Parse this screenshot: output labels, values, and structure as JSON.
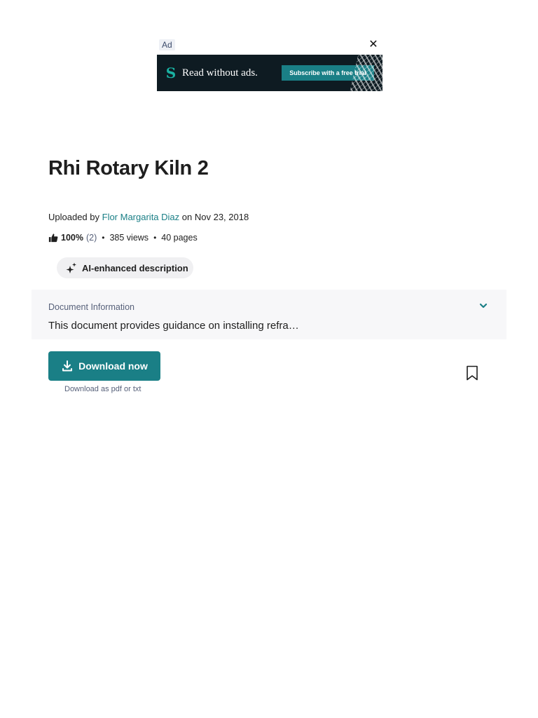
{
  "ad": {
    "tag": "Ad",
    "close_glyph": "✕",
    "logo_glyph": "S",
    "headline": "Read without ads.",
    "cta": "Subscribe with a free trial"
  },
  "document": {
    "title": "Rhi Rotary Kiln 2",
    "uploaded_prefix": "Uploaded by",
    "author": "Flor Margarita Diaz",
    "uploaded_suffix": "on Nov 23, 2018",
    "rating_percent": "100%",
    "rating_count": "(2)",
    "views": "385 views",
    "pages": "40 pages",
    "separator": "•"
  },
  "ai_pill": {
    "label": "AI-enhanced description",
    "icon": "sparkle-icon"
  },
  "info": {
    "label": "Document Information",
    "text": "This document provides guidance on installing refra…",
    "icon": "chevron-down-icon"
  },
  "download": {
    "button_label": "Download now",
    "sub_label": "Download as pdf or txt",
    "icon": "download-icon"
  },
  "bookmark": {
    "icon": "bookmark-icon"
  },
  "colors": {
    "accent": "#1a7f86",
    "ad_background": "#0e1b22",
    "panel_background": "#f7f7f9",
    "pill_background": "#f0f0f2"
  }
}
